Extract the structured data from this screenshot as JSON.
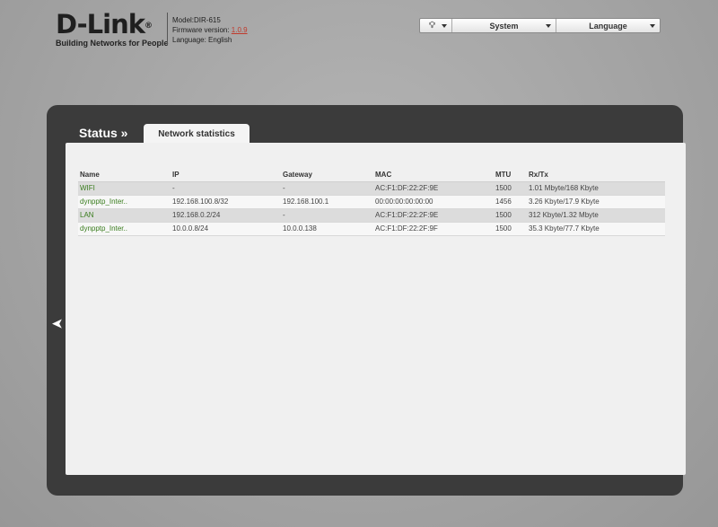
{
  "header": {
    "logo_text": "D-Link",
    "logo_reg": "®",
    "tagline": "Building Networks for People",
    "model_label": "Model:DIR-615",
    "firmware_label": "Firmware version: ",
    "firmware_value": "1.0.9",
    "language_label": "Language: English"
  },
  "topbar": {
    "bulb_icon": "lightbulb-icon",
    "system_label": "System",
    "language_label": "Language"
  },
  "breadcrumb": {
    "section": "Status »",
    "active_tab": "Network statistics"
  },
  "table": {
    "columns": [
      "Name",
      "IP",
      "Gateway",
      "MAC",
      "MTU",
      "Rx/Tx"
    ],
    "rows": [
      [
        "WIFI",
        "-",
        "-",
        "AC:F1:DF:22:2F:9E",
        "1500",
        "1.01 Mbyte/168 Kbyte"
      ],
      [
        "dynpptp_Inter..",
        "192.168.100.8/32",
        "192.168.100.1",
        "00:00:00:00:00:00",
        "1456",
        "3.26 Kbyte/17.9 Kbyte"
      ],
      [
        "LAN",
        "192.168.0.2/24",
        "-",
        "AC:F1:DF:22:2F:9E",
        "1500",
        "312 Kbyte/1.32 Mbyte"
      ],
      [
        "dynpptp_Inter..",
        "10.0.0.8/24",
        "10.0.0.138",
        "AC:F1:DF:22:2F:9F",
        "1500",
        "35.3 Kbyte/77.7 Kbyte"
      ]
    ]
  },
  "nav": {
    "back_icon": "chevron-left-icon"
  },
  "colors": {
    "link_green": "#3a7d1e",
    "firmware_red": "#c0392b",
    "panel_dark": "#3b3b3b"
  }
}
